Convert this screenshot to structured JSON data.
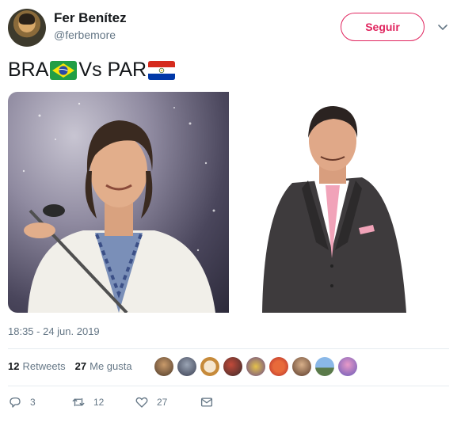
{
  "user": {
    "name": "Fer Benítez",
    "handle": "@ferbemore"
  },
  "follow_label": "Seguir",
  "tweet": {
    "text_part1": "BRA",
    "text_part2": " Vs PAR"
  },
  "timestamp": "18:35 - 24 jun. 2019",
  "stats": {
    "retweets_count": "12",
    "retweets_label": "Retweets",
    "likes_count": "27",
    "likes_label": "Me gusta"
  },
  "actions": {
    "reply_count": "3",
    "retweet_count": "12",
    "like_count": "27"
  },
  "colors": {
    "accent": "#e0245e",
    "text_secondary": "#657786"
  }
}
